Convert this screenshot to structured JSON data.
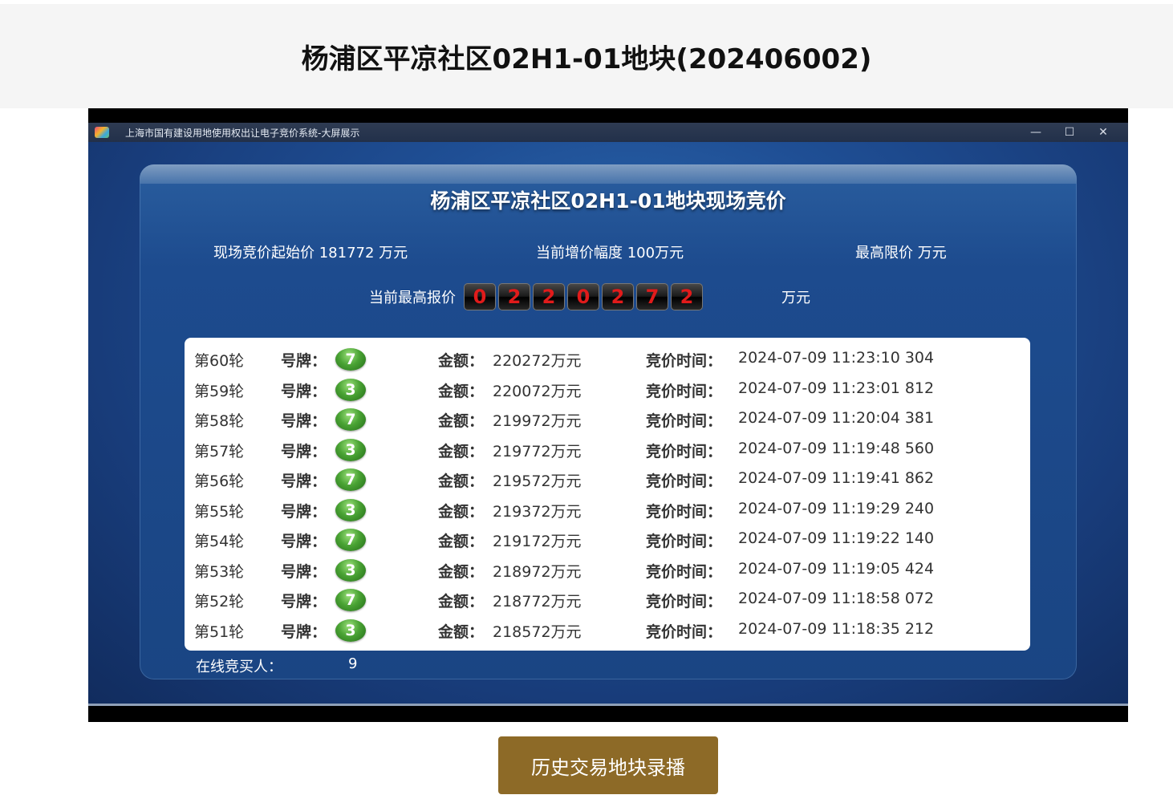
{
  "page": {
    "title": "杨浦区平凉社区02H1-01地块(202406002)"
  },
  "window": {
    "title": "上海市国有建设用地使用权出让电子竞价系统-大屏展示",
    "minimize": "—",
    "maximize": "☐",
    "close": "✕"
  },
  "auction": {
    "heading": "杨浦区平凉社区02H1-01地块现场竞价",
    "start_price": "现场竞价起始价 181772 万元",
    "increment": "当前增价幅度 100万元",
    "max_price": "最高限价 万元",
    "highest_bid_label": "当前最高报价",
    "highest_bid_digits": [
      "0",
      "2",
      "2",
      "0",
      "2",
      "7",
      "2"
    ],
    "highest_bid_unit": "万元",
    "online_label": "在线竞买人：",
    "online_count": "9"
  },
  "bids": [
    {
      "round": "第60轮",
      "plate_label": "号牌：",
      "plate": "7",
      "amount_label": "金额：",
      "amount": "220272万元",
      "time_label": "竞价时间：",
      "time": "2024-07-09 11:23:10 304"
    },
    {
      "round": "第59轮",
      "plate_label": "号牌：",
      "plate": "3",
      "amount_label": "金额：",
      "amount": "220072万元",
      "time_label": "竞价时间：",
      "time": "2024-07-09 11:23:01 812"
    },
    {
      "round": "第58轮",
      "plate_label": "号牌：",
      "plate": "7",
      "amount_label": "金额：",
      "amount": "219972万元",
      "time_label": "竞价时间：",
      "time": "2024-07-09 11:20:04 381"
    },
    {
      "round": "第57轮",
      "plate_label": "号牌：",
      "plate": "3",
      "amount_label": "金额：",
      "amount": "219772万元",
      "time_label": "竞价时间：",
      "time": "2024-07-09 11:19:48 560"
    },
    {
      "round": "第56轮",
      "plate_label": "号牌：",
      "plate": "7",
      "amount_label": "金额：",
      "amount": "219572万元",
      "time_label": "竞价时间：",
      "time": "2024-07-09 11:19:41 862"
    },
    {
      "round": "第55轮",
      "plate_label": "号牌：",
      "plate": "3",
      "amount_label": "金额：",
      "amount": "219372万元",
      "time_label": "竞价时间：",
      "time": "2024-07-09 11:19:29 240"
    },
    {
      "round": "第54轮",
      "plate_label": "号牌：",
      "plate": "7",
      "amount_label": "金额：",
      "amount": "219172万元",
      "time_label": "竞价时间：",
      "time": "2024-07-09 11:19:22 140"
    },
    {
      "round": "第53轮",
      "plate_label": "号牌：",
      "plate": "3",
      "amount_label": "金额：",
      "amount": "218972万元",
      "time_label": "竞价时间：",
      "time": "2024-07-09 11:19:05 424"
    },
    {
      "round": "第52轮",
      "plate_label": "号牌：",
      "plate": "7",
      "amount_label": "金额：",
      "amount": "218772万元",
      "time_label": "竞价时间：",
      "time": "2024-07-09 11:18:58 072"
    },
    {
      "round": "第51轮",
      "plate_label": "号牌：",
      "plate": "3",
      "amount_label": "金额：",
      "amount": "218572万元",
      "time_label": "竞价时间：",
      "time": "2024-07-09 11:18:35 212"
    }
  ],
  "replay_button": {
    "label": "历史交易地块录播"
  },
  "colors": {
    "button_brown": "#8d6a27",
    "digit_red": "#e11b1b",
    "badge_green": "#4aa334",
    "panel_blue": "#1d4b8e"
  }
}
